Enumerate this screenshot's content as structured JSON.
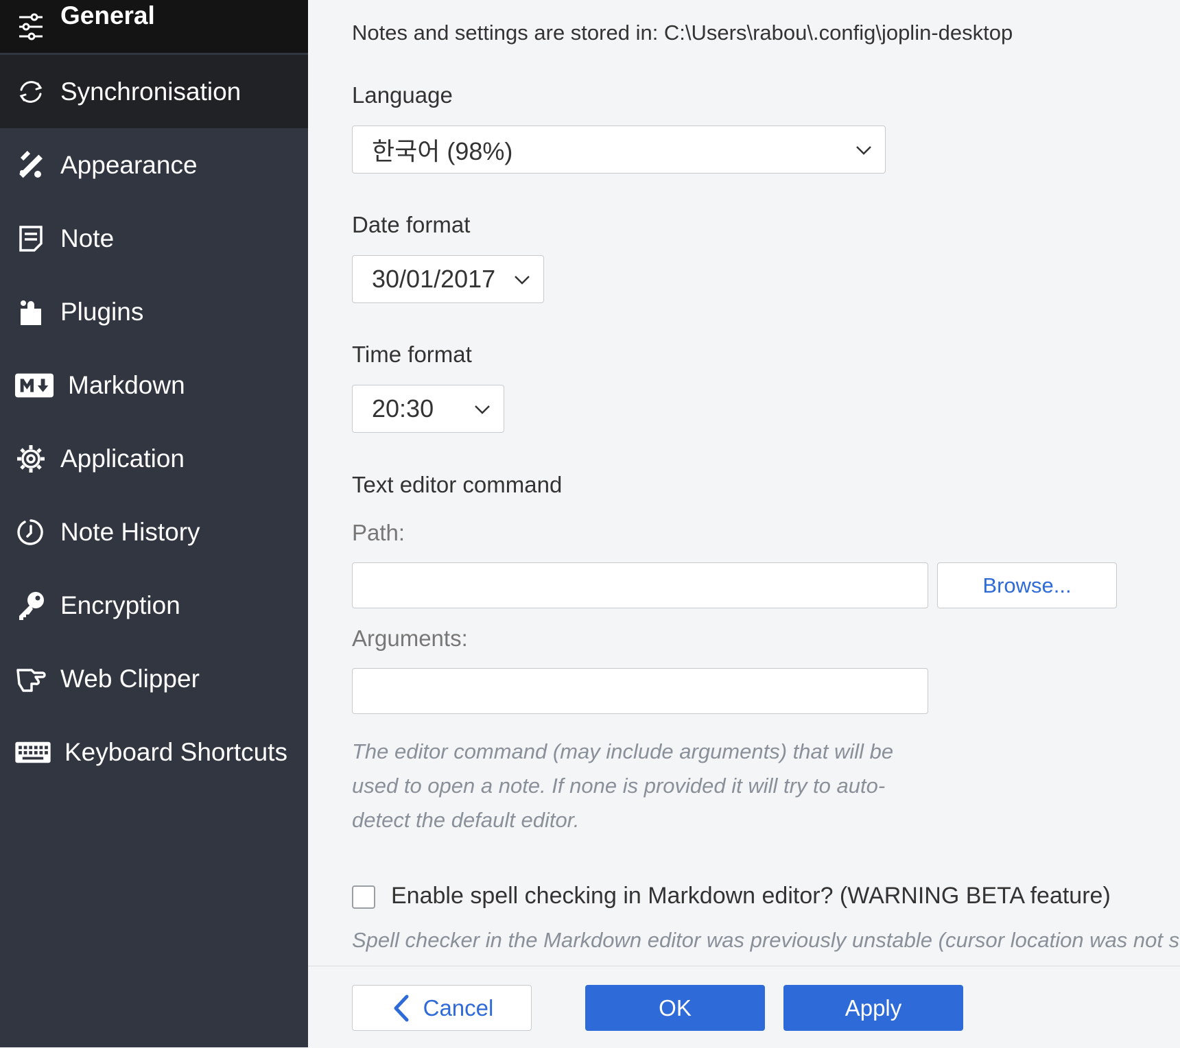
{
  "sidebar": {
    "items": [
      {
        "label": "General",
        "icon": "sliders-icon"
      },
      {
        "label": "Synchronisation",
        "icon": "sync-icon"
      },
      {
        "label": "Appearance",
        "icon": "palette-icon"
      },
      {
        "label": "Note",
        "icon": "note-icon"
      },
      {
        "label": "Plugins",
        "icon": "puzzle-icon"
      },
      {
        "label": "Markdown",
        "icon": "markdown-icon"
      },
      {
        "label": "Application",
        "icon": "gear-icon"
      },
      {
        "label": "Note History",
        "icon": "history-icon"
      },
      {
        "label": "Encryption",
        "icon": "key-icon"
      },
      {
        "label": "Web Clipper",
        "icon": "web-clipper-icon"
      },
      {
        "label": "Keyboard Shortcuts",
        "icon": "keyboard-icon"
      }
    ]
  },
  "general": {
    "storage_note": "Notes and settings are stored in: C:\\Users\\rabou\\.config\\joplin-desktop",
    "language": {
      "label": "Language",
      "value": "한국어 (98%)"
    },
    "date_format": {
      "label": "Date format",
      "value": "30/01/2017"
    },
    "time_format": {
      "label": "Time format",
      "value": "20:30"
    },
    "text_editor": {
      "label": "Text editor command",
      "path_label": "Path:",
      "path_value": "",
      "browse_label": "Browse...",
      "arguments_label": "Arguments:",
      "arguments_value": "",
      "help": "The editor command (may include arguments) that will be used to open a note. If none is provided it will try to auto-detect the default editor."
    },
    "spell_check": {
      "label": "Enable spell checking in Markdown editor? (WARNING BETA feature)",
      "checked": false,
      "help": "Spell checker in the Markdown editor was previously unstable (cursor location was not st"
    }
  },
  "footer": {
    "cancel_label": "Cancel",
    "ok_label": "OK",
    "apply_label": "Apply"
  },
  "colors": {
    "sidebar_bg": "#313640",
    "sidebar_selected": "#141414",
    "accent": "#2f6bd8",
    "content_bg": "#f4f5f6"
  }
}
